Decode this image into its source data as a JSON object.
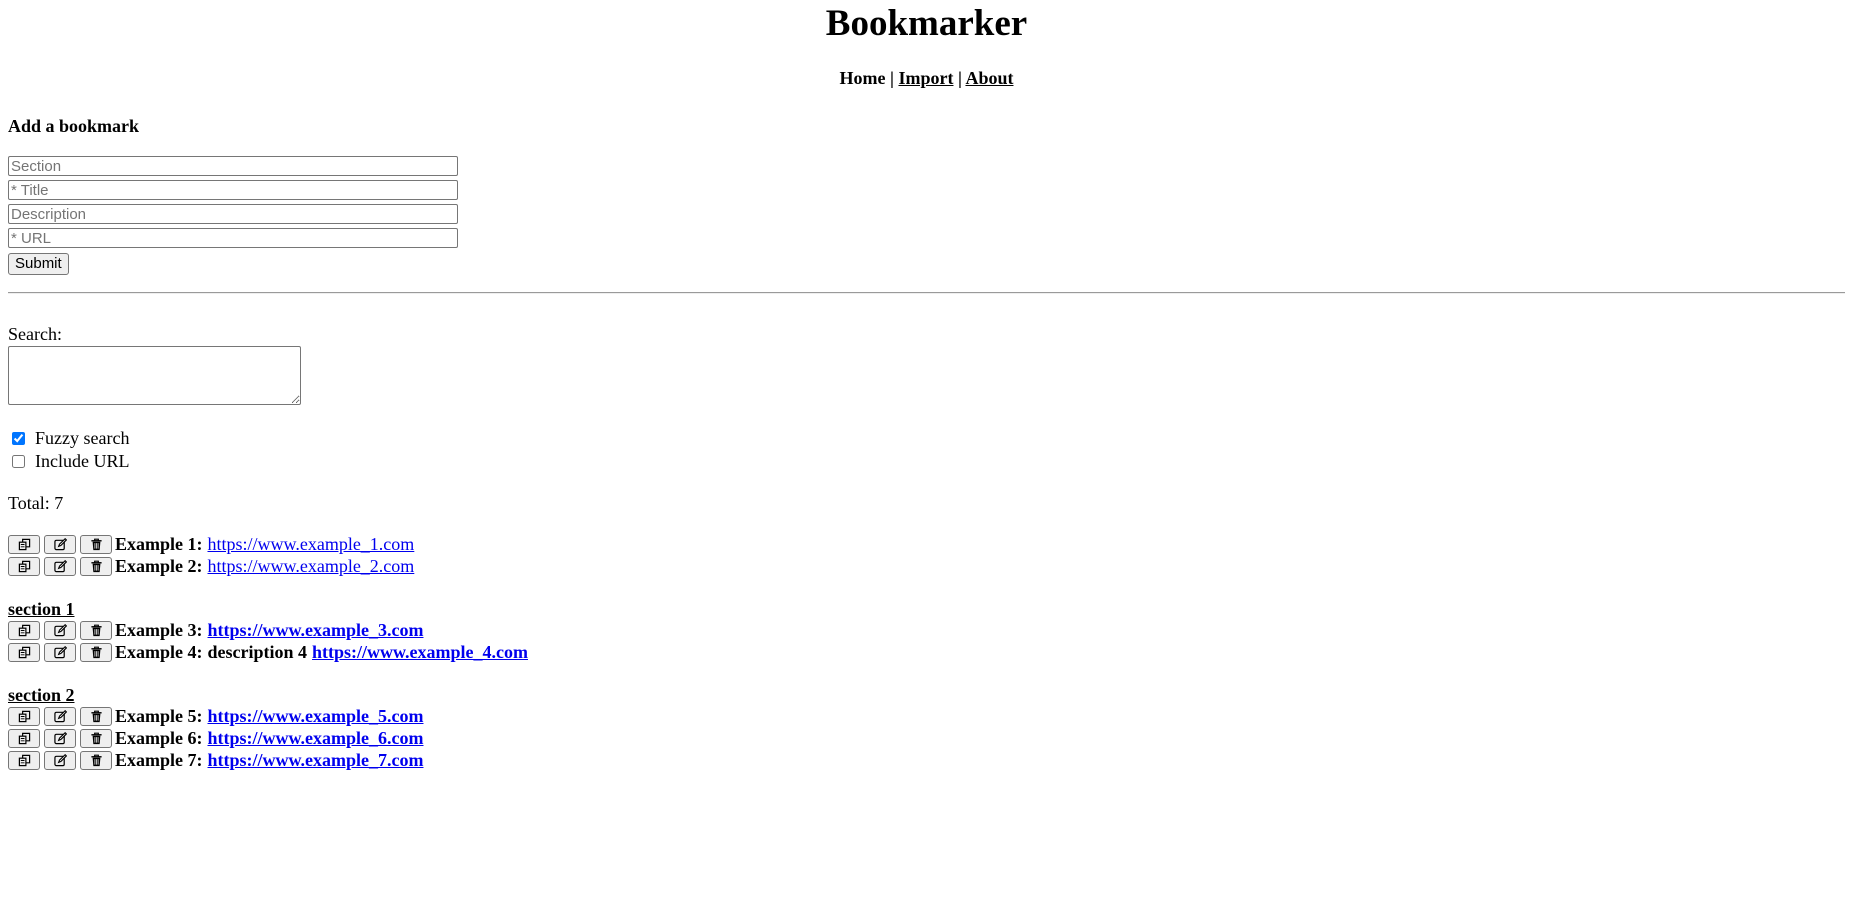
{
  "app": {
    "title": "Bookmarker"
  },
  "nav": {
    "home": "Home",
    "sep1": "|",
    "import": "Import",
    "sep2": "|",
    "about": "About"
  },
  "add_form": {
    "heading": "Add a bookmark",
    "section_placeholder": "Section",
    "title_placeholder": "* Title",
    "description_placeholder": "Description",
    "url_placeholder": "* URL",
    "submit_label": "Submit"
  },
  "search": {
    "label": "Search:",
    "value": "",
    "fuzzy_label": "Fuzzy search",
    "fuzzy_checked": true,
    "include_url_label": "Include URL",
    "include_url_checked": false
  },
  "total": {
    "text": "Total: 7"
  },
  "icons": {
    "copy": "copy-icon",
    "edit": "edit-icon",
    "delete": "trash-icon"
  },
  "colors": {
    "link": "#0000ee"
  },
  "unsectioned": [
    {
      "title": "Example 1:",
      "description": "",
      "url": "https://www.example_1.com"
    },
    {
      "title": "Example 2:",
      "description": "",
      "url": "https://www.example_2.com"
    }
  ],
  "sections": [
    {
      "name": "section 1",
      "items": [
        {
          "title": "Example 3:",
          "description": "",
          "url": "https://www.example_3.com"
        },
        {
          "title": "Example 4:",
          "description": "description 4",
          "url": "https://www.example_4.com"
        }
      ]
    },
    {
      "name": "section 2",
      "items": [
        {
          "title": "Example 5:",
          "description": "",
          "url": "https://www.example_5.com"
        },
        {
          "title": "Example 6:",
          "description": "",
          "url": "https://www.example_6.com"
        },
        {
          "title": "Example 7:",
          "description": "",
          "url": "https://www.example_7.com"
        }
      ]
    }
  ]
}
